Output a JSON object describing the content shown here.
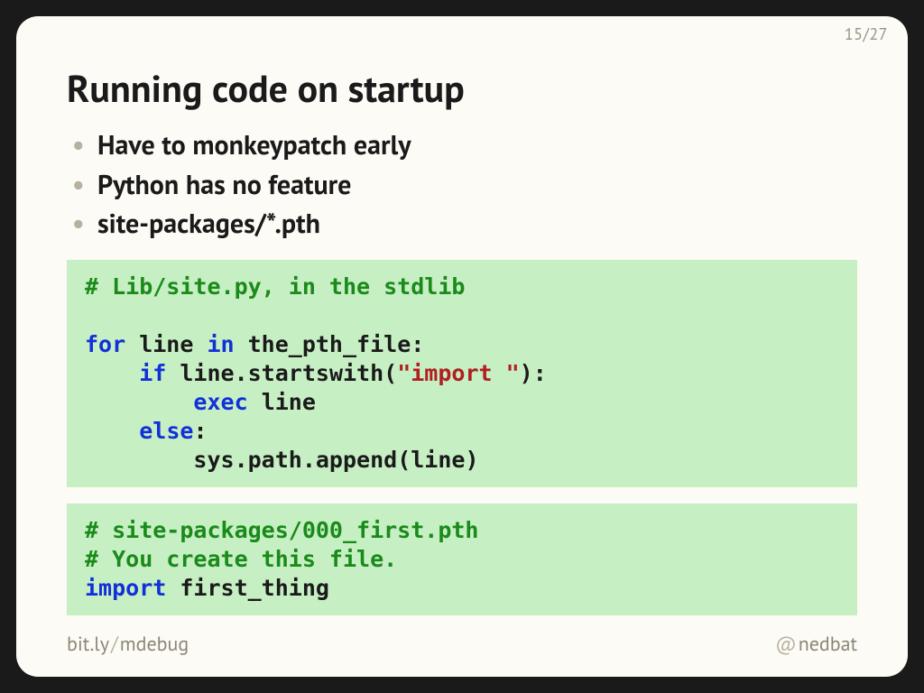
{
  "page": {
    "current": "15",
    "sep": "/",
    "total": "27"
  },
  "title": "Running code on startup",
  "bullets": [
    "Have to monkeypatch early",
    "Python has no feature",
    "site-packages/*.pth"
  ],
  "code1": {
    "c1": "# Lib/site.py, in the stdlib",
    "blank": "",
    "l1_kw": "for",
    "l1_a": " line ",
    "l1_in": "in",
    "l1_b": " the_pth_file:",
    "l2_pad": "    ",
    "l2_kw": "if",
    "l2_a": " line.startswith(",
    "l2_str": "\"import \"",
    "l2_b": "):",
    "l3_pad": "        ",
    "l3_kw": "exec",
    "l3_a": " line",
    "l4_pad": "    ",
    "l4_kw": "else",
    "l4_a": ":",
    "l5_pad": "        ",
    "l5_a": "sys.path.append(line)"
  },
  "code2": {
    "c1": "# site-packages/000_first.pth",
    "c2": "# You create this file.",
    "l1_kw": "import",
    "l1_a": " first_thing"
  },
  "footer": {
    "link_a": "bit.ly",
    "link_sep": "/",
    "link_b": "mdebug",
    "at": "@",
    "handle": "nedbat"
  }
}
